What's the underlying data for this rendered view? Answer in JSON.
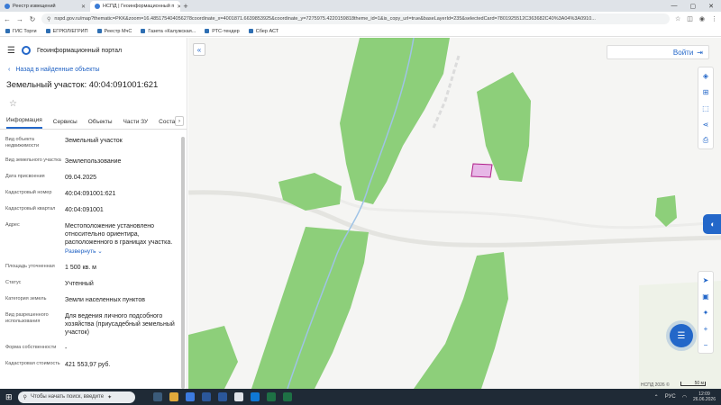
{
  "browser": {
    "tabs": [
      {
        "label": "Реестр извещений",
        "active": false
      },
      {
        "label": "НСПД | Геоинформационный п",
        "active": true
      }
    ],
    "url": "nspd.gov.ru/map?thematic=PKK&zoom=16.485175404056278coordinate_x=4001871.6639853925&coordinate_y=7275975.4220159818theme_id=1&is_copy_url=true&baseLayerId=235&selectedCard=7801925512C363682C40%3A04%3A0910...",
    "bookmarks": [
      "ГИС Торги",
      "ЕГРЮЛ/ЕГРИП",
      "Реестр МчС",
      "Газета «Калужская...",
      "РТС-тендер",
      "Сбер АСТ"
    ]
  },
  "panel": {
    "portal_name": "Геоинформационный портал",
    "back_link": "Назад в найденные объекты",
    "title": "Земельный участок: 40:04:091001:621",
    "tabs": [
      "Информация",
      "Сервисы",
      "Объекты",
      "Части ЗУ",
      "Состав"
    ],
    "rows": [
      {
        "label": "Вид объекта недвижимости",
        "value": "Земельный участок"
      },
      {
        "label": "Вид земельного участка",
        "value": "Землепользование"
      },
      {
        "label": "Дата присвоения",
        "value": "09.04.2025"
      },
      {
        "label": "Кадастровый номер",
        "value": "40:04:091001:621"
      },
      {
        "label": "Кадастровый квартал",
        "value": "40:04:091001"
      },
      {
        "label": "Адрес",
        "value": "Местоположение установлено относительно ориентира, расположенного в границах участка.",
        "expand": "Развернуть"
      },
      {
        "label": "Площадь уточненная",
        "value": "1 500 кв. м"
      },
      {
        "label": "Статус",
        "value": "Учтенный"
      },
      {
        "label": "Категория земель",
        "value": "Земли населенных пунктов"
      },
      {
        "label": "Вид разрешенного использования",
        "value": "Для ведения личного подсобного хозяйства (приусадебный земельный участок)"
      },
      {
        "label": "Форма собственности",
        "value": "-"
      },
      {
        "label": "Кадастровая стоимость",
        "value": "421 553,97 руб."
      }
    ]
  },
  "map": {
    "login_label": "Войти",
    "copyright": "НСПД 2026 ©",
    "scale_label": "50 м",
    "colors": {
      "forest": "#8dcf7a",
      "parcel": "#e7b7e7",
      "parcel_border": "#b0208a",
      "stream": "#9fc3e6",
      "road": "#e9e9e6",
      "accent": "#2367c9"
    }
  },
  "taskbar": {
    "search_placeholder": "Чтобы начать поиск, введите",
    "lang": "РУС",
    "time": "12:09",
    "date": "26.06.2026"
  }
}
